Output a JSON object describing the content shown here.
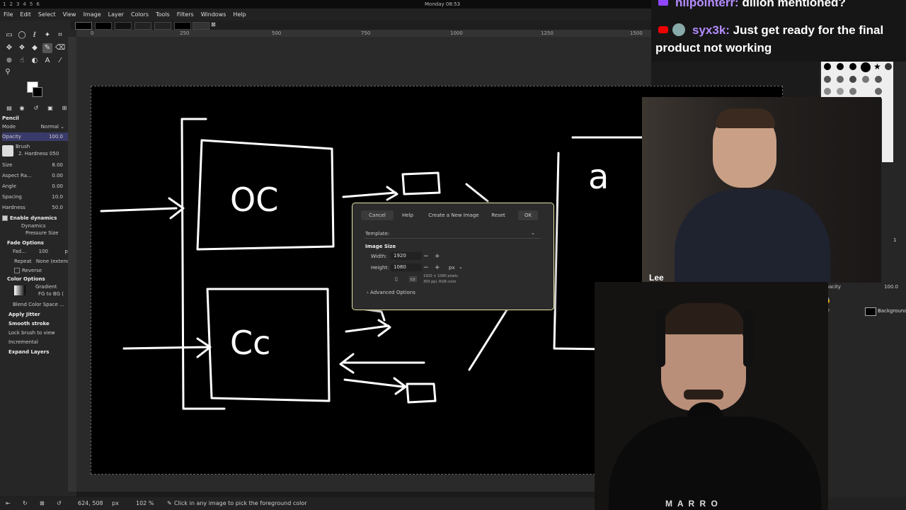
{
  "topbar": {
    "workspaces": [
      "1",
      "2",
      "3",
      "4",
      "5",
      "6"
    ],
    "clock": "Monday 08:53"
  },
  "menubar": {
    "items": [
      "File",
      "Edit",
      "Select",
      "View",
      "Image",
      "Layer",
      "Colors",
      "Tools",
      "Filters",
      "Windows",
      "Help"
    ]
  },
  "ruler": {
    "ticks": [
      "0",
      "250",
      "500",
      "750",
      "1000",
      "1250",
      "1500"
    ]
  },
  "tool_options": {
    "title": "Pencil",
    "mode_label": "Mode",
    "mode_value": "Normal",
    "opacity_label": "Opacity",
    "opacity_value": "100.0",
    "brush_label": "Brush",
    "brush_value": "2. Hardness 050",
    "size_label": "Size",
    "size_value": "8.00",
    "aspect_label": "Aspect Ra...",
    "aspect_value": "0.00",
    "angle_label": "Angle",
    "angle_value": "0.00",
    "spacing_label": "Spacing",
    "spacing_value": "10.0",
    "hardness_label": "Hardness",
    "hardness_value": "50.0",
    "enable_dynamics": "Enable dynamics",
    "dynamics_label": "Dynamics",
    "dynamics_value": "Pressure Size",
    "fade_options": "Fade Options",
    "fade_label": "Fad...",
    "fade_value": "100",
    "fade_unit": "px",
    "repeat_label": "Repeat",
    "repeat_value": "None (extend)",
    "reverse_label": "Reverse",
    "color_options": "Color Options",
    "gradient_label": "Gradient",
    "gradient_value": "FG to BG (",
    "blend_label": "Blend Color Space ...",
    "apply_jitter": "Apply Jitter",
    "smooth_stroke": "Smooth stroke",
    "lock_brush": "Lock brush to view",
    "incremental": "Incremental",
    "expand_layers": "Expand Layers"
  },
  "drawing": {
    "box1_text": "OC",
    "box2_text": "Cc",
    "box3_text": "a"
  },
  "dialog": {
    "title": "Create a New Image",
    "cancel": "Cancel",
    "help": "Help",
    "reset": "Reset",
    "ok": "OK",
    "template_label": "Template:",
    "image_size_label": "Image Size",
    "width_label": "Width:",
    "width_value": "1920",
    "height_label": "Height:",
    "height_value": "1080",
    "unit": "px",
    "info_line1": "1920 × 1080 pixels",
    "info_line2": "300 ppi, RGB color",
    "advanced": "Advanced Options"
  },
  "statusbar": {
    "coords": "624, 508",
    "unit": "px",
    "zoom": "102 %",
    "message": "Click in any image to pick the foreground color"
  },
  "chat": {
    "line1_user": "nilpointerr:",
    "line1_text": "dillon mentioned?",
    "line2_user": "syx3k:",
    "line2_text": "Just get ready for the final",
    "line3_text": "product not working"
  },
  "layers": {
    "opacity_label": "Opacity",
    "opacity_value": "100.0",
    "layer_name": "Background",
    "page_indicator": "1"
  },
  "webcam": {
    "name_tag": "Lee",
    "shirt_text": "M A R R O"
  },
  "colors": {
    "accent_dialog_border": "#e8e6a8",
    "chat_user1": "#b48cff",
    "chat_user2": "#b48cff",
    "canvas_bg": "#000000",
    "stroke": "#ffffff"
  }
}
